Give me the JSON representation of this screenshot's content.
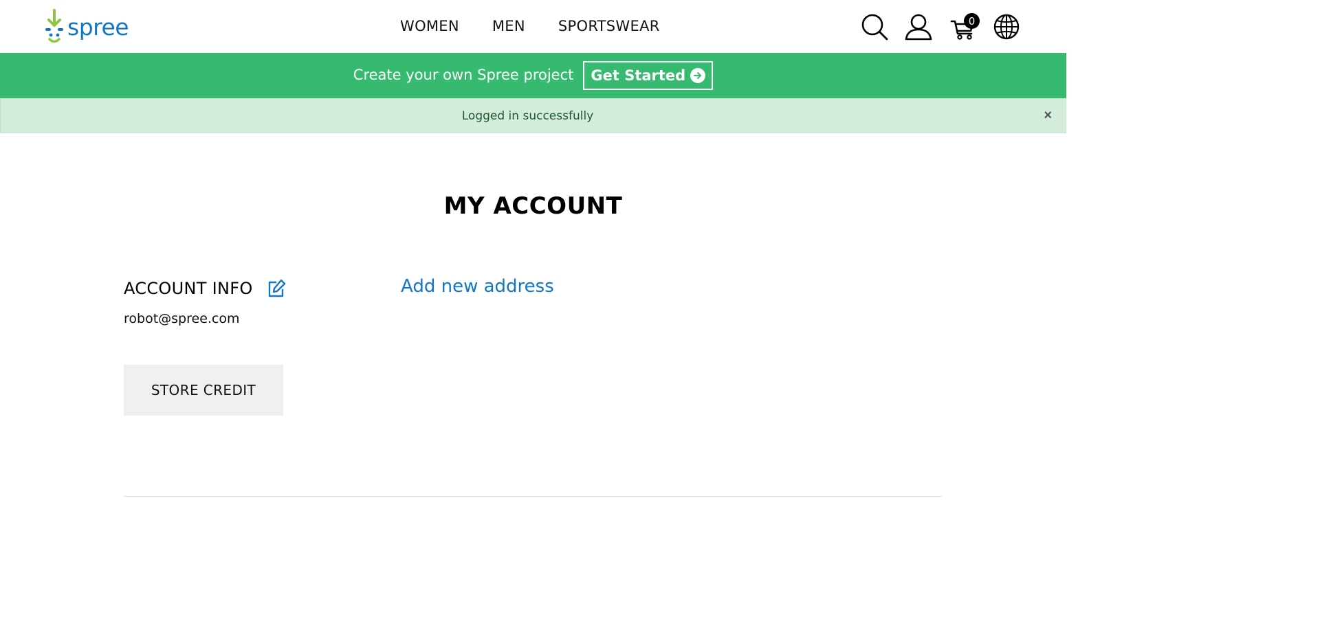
{
  "header": {
    "logo_text": "spree",
    "nav": [
      "WOMEN",
      "MEN",
      "SPORTSWEAR"
    ],
    "cart_count": "0",
    "icons": [
      "search-icon",
      "account-icon",
      "cart-icon",
      "globe-icon"
    ]
  },
  "promo": {
    "text": "Create your own Spree project",
    "button_label": "Get Started"
  },
  "flash": {
    "message": "Logged in successfully",
    "close_label": "×"
  },
  "main": {
    "title": "MY ACCOUNT",
    "account_info_heading": "ACCOUNT INFO",
    "email": "robot@spree.com",
    "store_credit_label": "STORE CREDIT",
    "add_address_label": "Add new address"
  },
  "colors": {
    "brand_blue": "#1276c6",
    "brand_green": "#36ba6f",
    "flash_bg": "#d4ecdb",
    "flash_text": "#1d5a2e"
  }
}
